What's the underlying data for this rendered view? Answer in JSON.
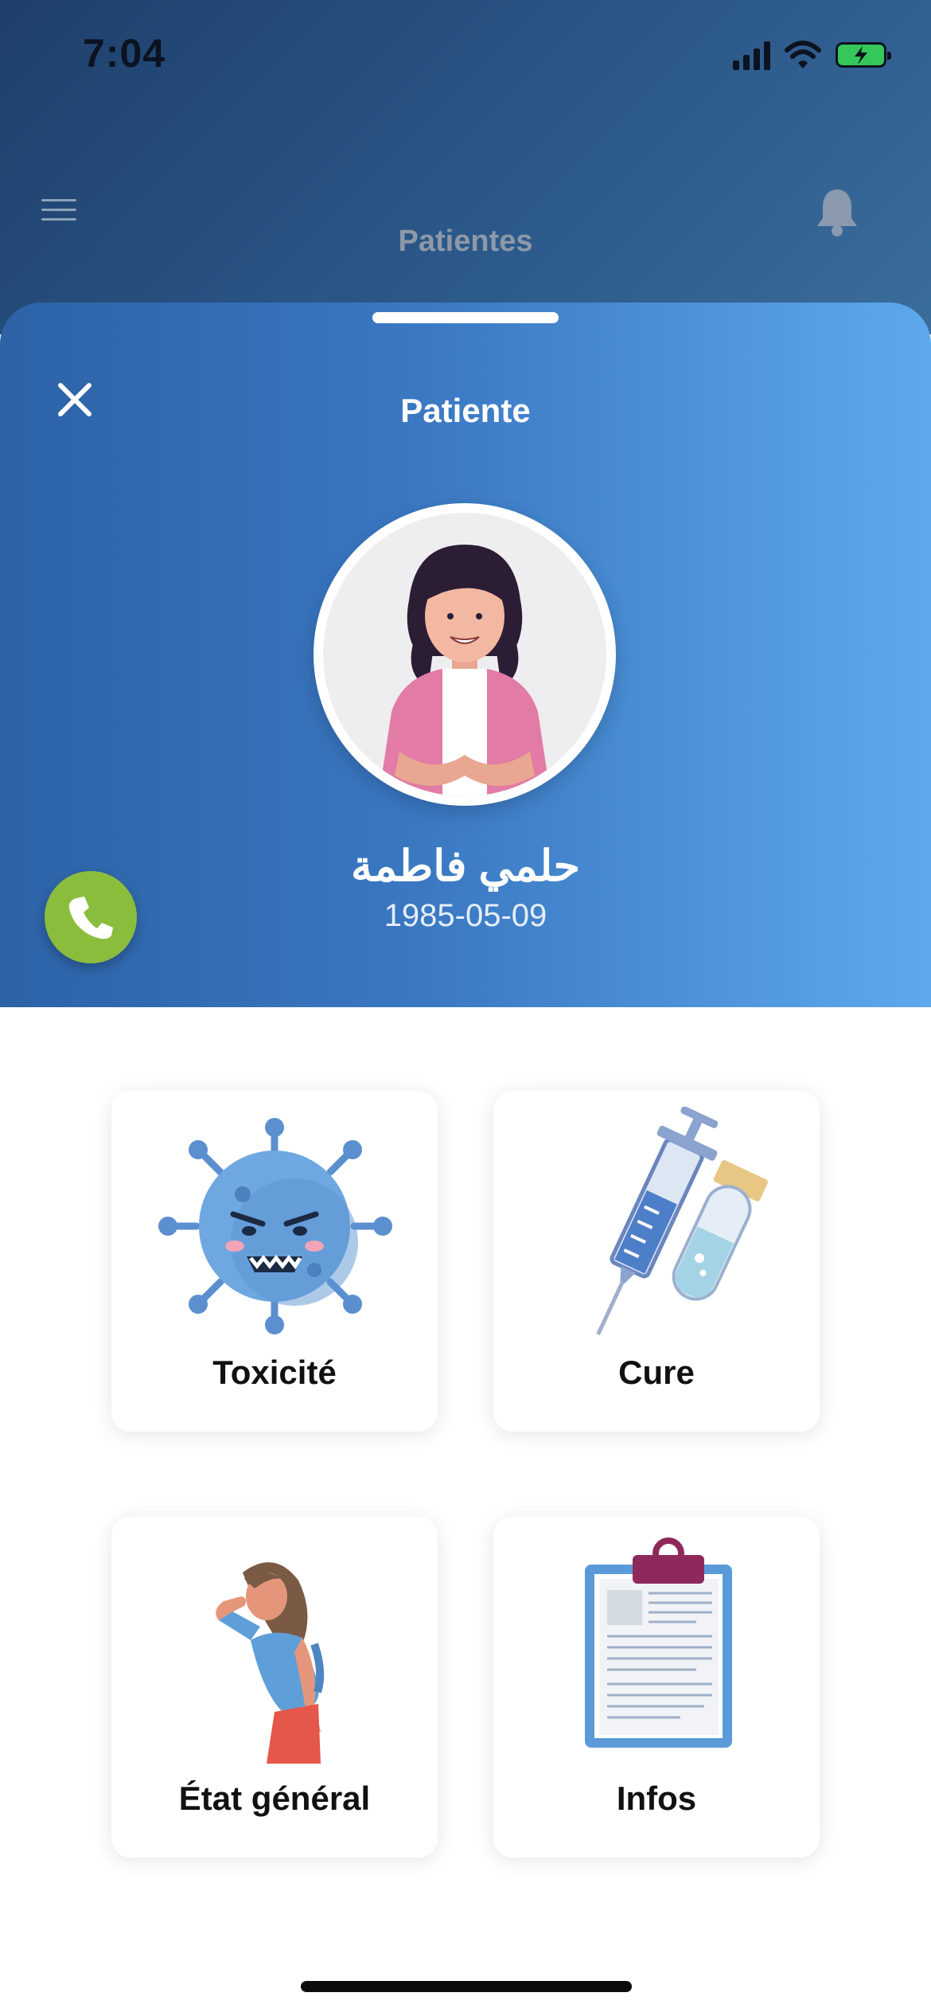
{
  "status": {
    "time": "7:04"
  },
  "header": {
    "title": "Patientes"
  },
  "sheet": {
    "title": "Patiente",
    "patient": {
      "name": "حلمي فاطمة",
      "dob": "1985-05-09"
    }
  },
  "cards": [
    {
      "label": "Toxicité",
      "icon": "virus-icon"
    },
    {
      "label": "Cure",
      "icon": "syringe-vial-icon"
    },
    {
      "label": "État général",
      "icon": "woman-headache-icon"
    },
    {
      "label": "Infos",
      "icon": "clipboard-icon"
    }
  ],
  "colors": {
    "accent_blue": "#3a78c2",
    "call_green": "#8bbd3d",
    "header_dark": "#1f3f6b"
  }
}
